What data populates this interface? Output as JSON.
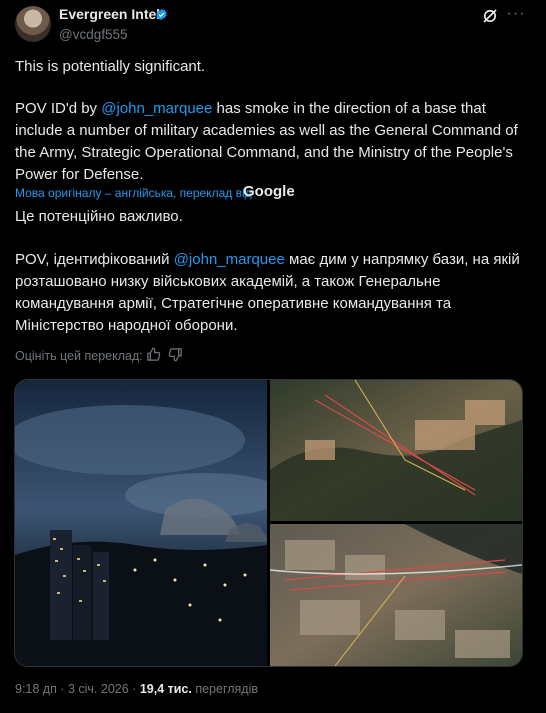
{
  "author": {
    "name": "Evergreen Intel",
    "handle": "@vcdgf555"
  },
  "post": {
    "line1": "This is potentially significant.",
    "p2_a": "POV ID'd by ",
    "p2_mention": "@john_marquee",
    "p2_b": " has smoke in the direction of a base that include a number of military academies as well as the General Command of the Army, Strategic Operational Command, and the Ministry of the People's Power for Defense."
  },
  "translation": {
    "note": "Мова оригіналу – англійська, переклад від",
    "provider": "Google",
    "line1": "Це потенційно важливо.",
    "p2_a": "POV, ідентифікований ",
    "p2_mention": "@john_marquee",
    "p2_b": " має дим у напрямку бази, на якій розташовано низку військових академій, а також Генеральне командування армії, Стратегічне оперативне командування та Міністерство народної оборони.",
    "rate_label": "Оцініть цей переклад:"
  },
  "footer": {
    "time": "9:18 дп · 3 січ. 2026 · ",
    "views_count": "19,4 тис.",
    "views_label": " переглядів"
  },
  "icons": {
    "verified": "verified-badge-icon",
    "grok": "grok-icon",
    "more": "more-icon",
    "like": "thumbs-up-icon",
    "dislike": "thumbs-down-icon"
  },
  "colors": {
    "accent": "#1d9bf0",
    "muted": "#71767b",
    "text": "#e7e9ea",
    "background": "#000000"
  }
}
